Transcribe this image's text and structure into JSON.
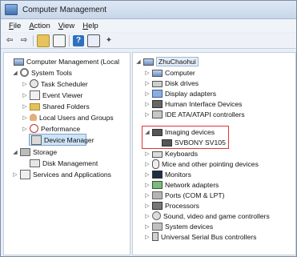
{
  "window": {
    "title": "Computer Management"
  },
  "menu": [
    {
      "key": "F",
      "rest": "ile"
    },
    {
      "key": "A",
      "rest": "ction"
    },
    {
      "key": "V",
      "rest": "iew"
    },
    {
      "key": "H",
      "rest": "elp"
    }
  ],
  "left_tree": {
    "root": "Computer Management (Local",
    "system_tools": "System Tools",
    "task_scheduler": "Task Scheduler",
    "event_viewer": "Event Viewer",
    "shared_folders": "Shared Folders",
    "local_users_groups": "Local Users and Groups",
    "performance": "Performance",
    "device_manager": "Device Manager",
    "storage": "Storage",
    "disk_management": "Disk Management",
    "services_apps": "Services and Applications"
  },
  "right_tree": {
    "root": "ZhuChaohui",
    "items": [
      "Computer",
      "Disk drives",
      "Display adapters",
      "Human Interface Devices",
      "IDE ATA/ATAPI controllers",
      "Imaging devices",
      "SVBONY SV105",
      "Keyboards",
      "Mice and other pointing devices",
      "Monitors",
      "Network adapters",
      "Ports (COM & LPT)",
      "Processors",
      "Sound, video and game controllers",
      "System devices",
      "Universal Serial Bus controllers"
    ]
  },
  "accent": {
    "highlight_border": "#d93838",
    "selection_bg": "#cde4f7"
  }
}
